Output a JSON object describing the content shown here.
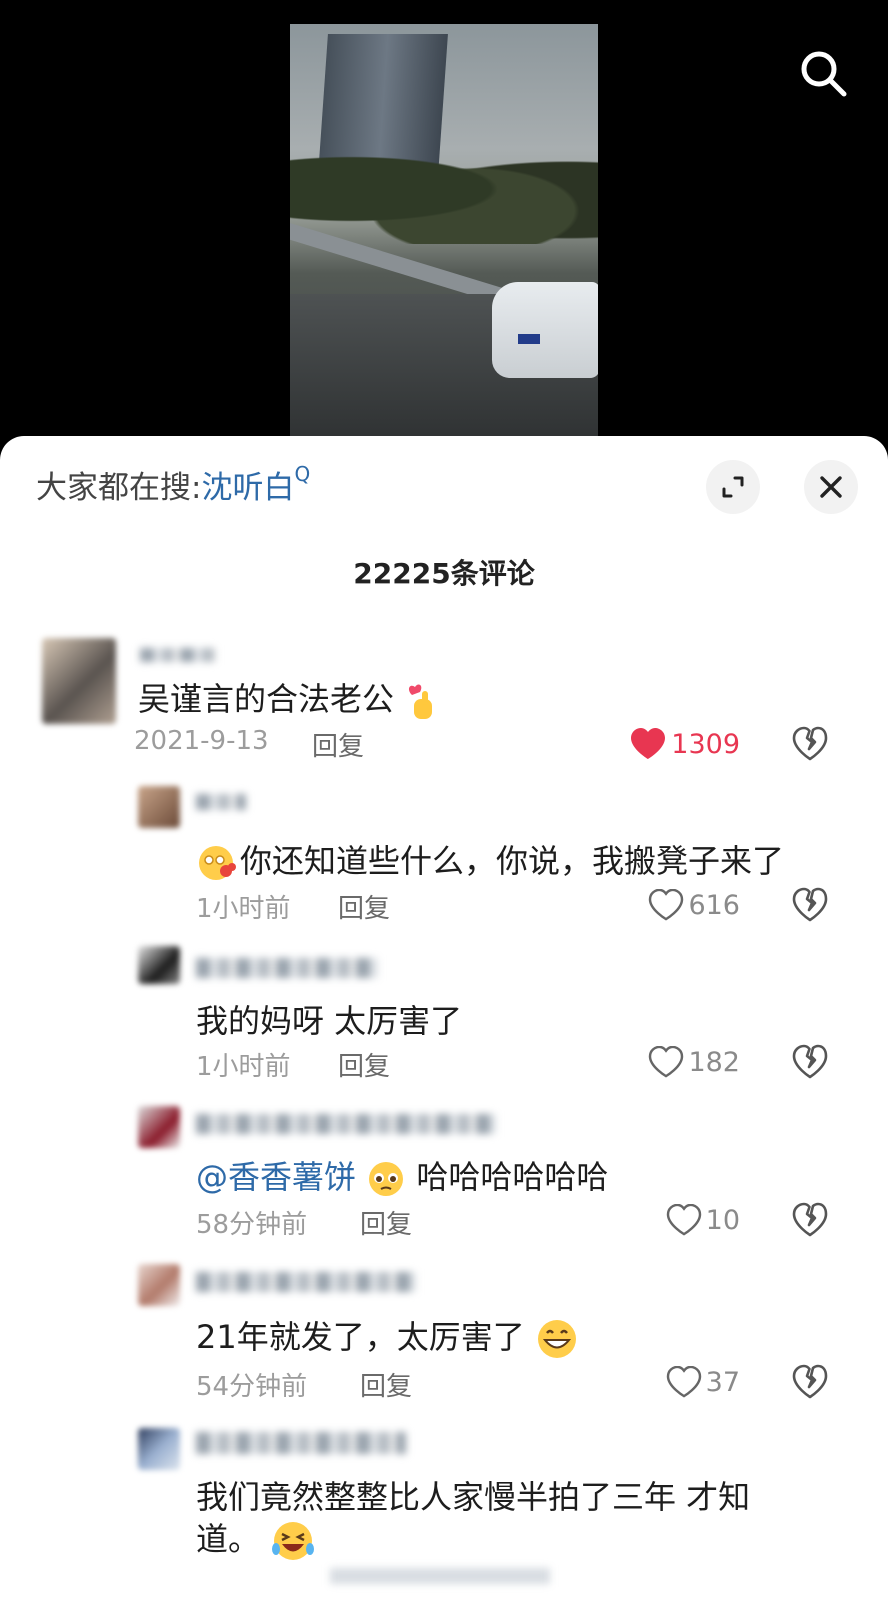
{
  "search_hint": {
    "prefix": "大家都在搜:",
    "keyword": "沈听白",
    "glyph": "Q"
  },
  "comment_count": "22225条评论",
  "comments": [
    {
      "text": "吴谨言的合法老公",
      "time": "2021-9-13",
      "reply": "回复",
      "likes": "1309",
      "liked": true
    },
    {
      "text": "你还知道些什么，你说，我搬凳子来了",
      "time": "1小时前",
      "reply": "回复",
      "likes": "616",
      "liked": false
    },
    {
      "text": "我的妈呀 太厉害了",
      "time": "1小时前",
      "reply": "回复",
      "likes": "182",
      "liked": false
    },
    {
      "mention": "@香香薯饼",
      "text": "哈哈哈哈哈哈",
      "time": "58分钟前",
      "reply": "回复",
      "likes": "10",
      "liked": false
    },
    {
      "text": "21年就发了，太厉害了",
      "time": "54分钟前",
      "reply": "回复",
      "likes": "37",
      "liked": false
    },
    {
      "text_line1": "我们竟然整整比人家慢半拍了三年 才知",
      "text_line2": "道。"
    }
  ],
  "colors": {
    "accent": "#2e6aa8",
    "liked": "#e83651",
    "muted": "#9c9c9c"
  },
  "icons": [
    "search-icon",
    "expand-icon",
    "close-icon",
    "heart-icon",
    "dislike-icon",
    "finger-heart-emoji",
    "blushing-emoji",
    "pleading-emoji",
    "grinning-emoji",
    "laughing-emoji"
  ]
}
